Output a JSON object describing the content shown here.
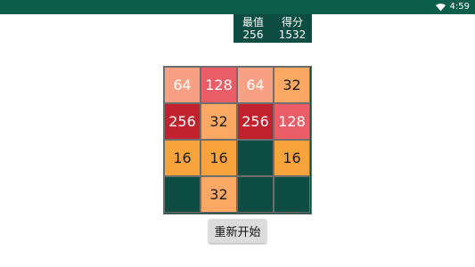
{
  "status_bar": {
    "time": "4:59",
    "wifi_icon": "wifi-icon",
    "background_color": "#0b5f4a"
  },
  "score_panel": {
    "best_label": "最值",
    "best_value": "256",
    "score_label": "得分",
    "score_value": "1532",
    "background_color": "#0e4d42"
  },
  "board": {
    "empty_color": "#0e4d42",
    "grid": [
      [
        "64",
        "128",
        "64",
        "32"
      ],
      [
        "256",
        "32",
        "256",
        "128"
      ],
      [
        "16",
        "16",
        "",
        "16"
      ],
      [
        "",
        "32",
        "",
        ""
      ]
    ],
    "tile_colors": {
      "16": "#f9a33d",
      "32": "#fca865",
      "64": "#f7a083",
      "128": "#ea5d66",
      "256": "#c1222e"
    },
    "light_text_values": [
      "64",
      "128",
      "256"
    ]
  },
  "restart_button": {
    "label": "重新开始"
  }
}
